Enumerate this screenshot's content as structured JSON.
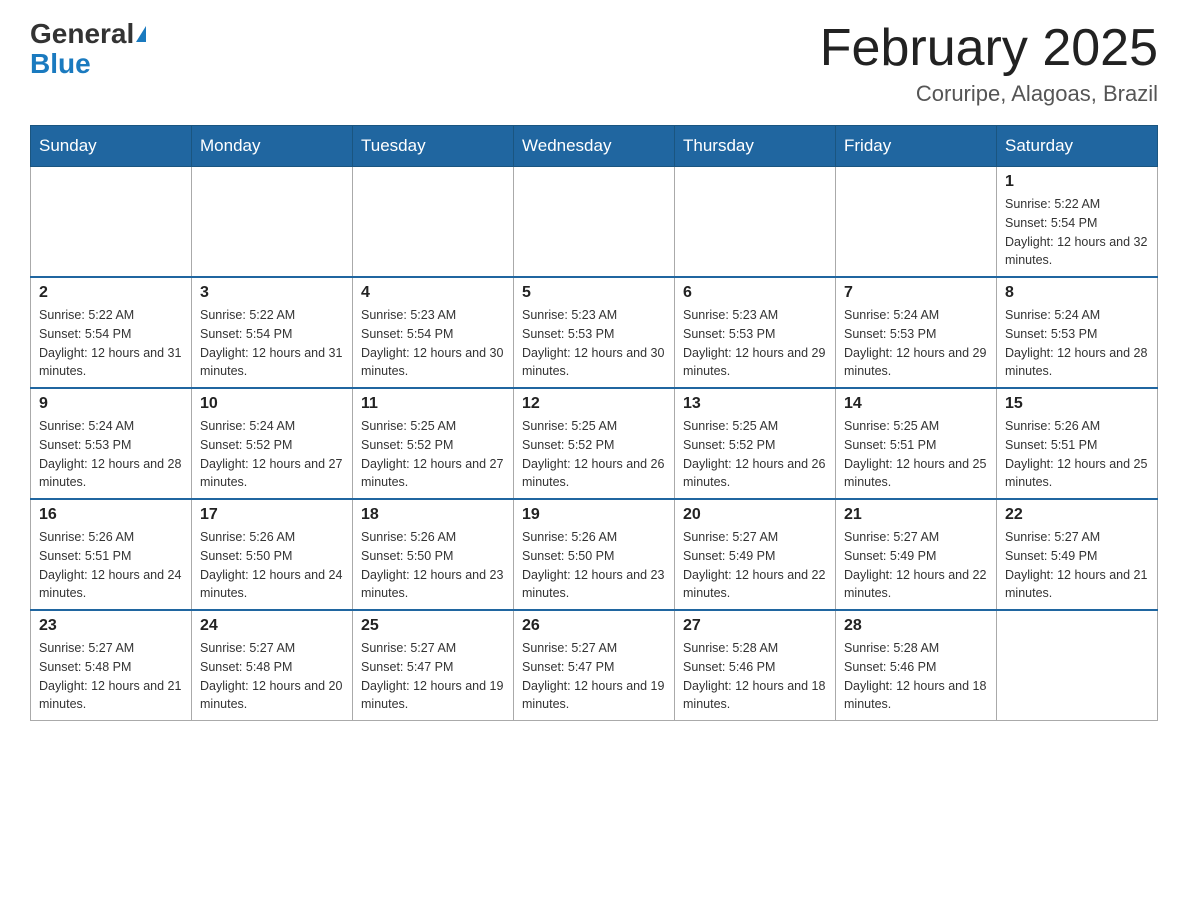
{
  "header": {
    "logo_general": "General",
    "logo_blue": "Blue",
    "month_title": "February 2025",
    "location": "Coruripe, Alagoas, Brazil"
  },
  "days_of_week": [
    "Sunday",
    "Monday",
    "Tuesday",
    "Wednesday",
    "Thursday",
    "Friday",
    "Saturday"
  ],
  "weeks": [
    [
      {
        "day": "",
        "info": ""
      },
      {
        "day": "",
        "info": ""
      },
      {
        "day": "",
        "info": ""
      },
      {
        "day": "",
        "info": ""
      },
      {
        "day": "",
        "info": ""
      },
      {
        "day": "",
        "info": ""
      },
      {
        "day": "1",
        "info": "Sunrise: 5:22 AM\nSunset: 5:54 PM\nDaylight: 12 hours and 32 minutes."
      }
    ],
    [
      {
        "day": "2",
        "info": "Sunrise: 5:22 AM\nSunset: 5:54 PM\nDaylight: 12 hours and 31 minutes."
      },
      {
        "day": "3",
        "info": "Sunrise: 5:22 AM\nSunset: 5:54 PM\nDaylight: 12 hours and 31 minutes."
      },
      {
        "day": "4",
        "info": "Sunrise: 5:23 AM\nSunset: 5:54 PM\nDaylight: 12 hours and 30 minutes."
      },
      {
        "day": "5",
        "info": "Sunrise: 5:23 AM\nSunset: 5:53 PM\nDaylight: 12 hours and 30 minutes."
      },
      {
        "day": "6",
        "info": "Sunrise: 5:23 AM\nSunset: 5:53 PM\nDaylight: 12 hours and 29 minutes."
      },
      {
        "day": "7",
        "info": "Sunrise: 5:24 AM\nSunset: 5:53 PM\nDaylight: 12 hours and 29 minutes."
      },
      {
        "day": "8",
        "info": "Sunrise: 5:24 AM\nSunset: 5:53 PM\nDaylight: 12 hours and 28 minutes."
      }
    ],
    [
      {
        "day": "9",
        "info": "Sunrise: 5:24 AM\nSunset: 5:53 PM\nDaylight: 12 hours and 28 minutes."
      },
      {
        "day": "10",
        "info": "Sunrise: 5:24 AM\nSunset: 5:52 PM\nDaylight: 12 hours and 27 minutes."
      },
      {
        "day": "11",
        "info": "Sunrise: 5:25 AM\nSunset: 5:52 PM\nDaylight: 12 hours and 27 minutes."
      },
      {
        "day": "12",
        "info": "Sunrise: 5:25 AM\nSunset: 5:52 PM\nDaylight: 12 hours and 26 minutes."
      },
      {
        "day": "13",
        "info": "Sunrise: 5:25 AM\nSunset: 5:52 PM\nDaylight: 12 hours and 26 minutes."
      },
      {
        "day": "14",
        "info": "Sunrise: 5:25 AM\nSunset: 5:51 PM\nDaylight: 12 hours and 25 minutes."
      },
      {
        "day": "15",
        "info": "Sunrise: 5:26 AM\nSunset: 5:51 PM\nDaylight: 12 hours and 25 minutes."
      }
    ],
    [
      {
        "day": "16",
        "info": "Sunrise: 5:26 AM\nSunset: 5:51 PM\nDaylight: 12 hours and 24 minutes."
      },
      {
        "day": "17",
        "info": "Sunrise: 5:26 AM\nSunset: 5:50 PM\nDaylight: 12 hours and 24 minutes."
      },
      {
        "day": "18",
        "info": "Sunrise: 5:26 AM\nSunset: 5:50 PM\nDaylight: 12 hours and 23 minutes."
      },
      {
        "day": "19",
        "info": "Sunrise: 5:26 AM\nSunset: 5:50 PM\nDaylight: 12 hours and 23 minutes."
      },
      {
        "day": "20",
        "info": "Sunrise: 5:27 AM\nSunset: 5:49 PM\nDaylight: 12 hours and 22 minutes."
      },
      {
        "day": "21",
        "info": "Sunrise: 5:27 AM\nSunset: 5:49 PM\nDaylight: 12 hours and 22 minutes."
      },
      {
        "day": "22",
        "info": "Sunrise: 5:27 AM\nSunset: 5:49 PM\nDaylight: 12 hours and 21 minutes."
      }
    ],
    [
      {
        "day": "23",
        "info": "Sunrise: 5:27 AM\nSunset: 5:48 PM\nDaylight: 12 hours and 21 minutes."
      },
      {
        "day": "24",
        "info": "Sunrise: 5:27 AM\nSunset: 5:48 PM\nDaylight: 12 hours and 20 minutes."
      },
      {
        "day": "25",
        "info": "Sunrise: 5:27 AM\nSunset: 5:47 PM\nDaylight: 12 hours and 19 minutes."
      },
      {
        "day": "26",
        "info": "Sunrise: 5:27 AM\nSunset: 5:47 PM\nDaylight: 12 hours and 19 minutes."
      },
      {
        "day": "27",
        "info": "Sunrise: 5:28 AM\nSunset: 5:46 PM\nDaylight: 12 hours and 18 minutes."
      },
      {
        "day": "28",
        "info": "Sunrise: 5:28 AM\nSunset: 5:46 PM\nDaylight: 12 hours and 18 minutes."
      },
      {
        "day": "",
        "info": ""
      }
    ]
  ]
}
